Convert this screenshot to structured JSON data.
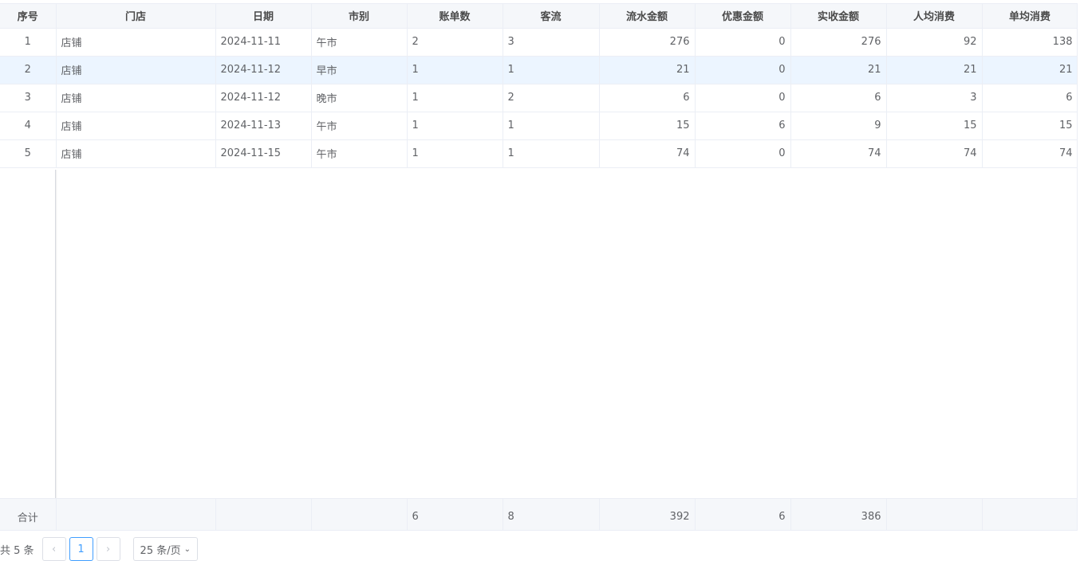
{
  "columns": [
    "序号",
    "门店",
    "日期",
    "市别",
    "账单数",
    "客流",
    "流水金额",
    "优惠金额",
    "实收金额",
    "人均消费",
    "单均消费"
  ],
  "rows": [
    [
      "1",
      "店铺",
      "2024-11-11",
      "午市",
      "2",
      "3",
      "276",
      "0",
      "276",
      "92",
      "138"
    ],
    [
      "2",
      "店铺",
      "2024-11-12",
      "早市",
      "1",
      "1",
      "21",
      "0",
      "21",
      "21",
      "21"
    ],
    [
      "3",
      "店铺",
      "2024-11-12",
      "晚市",
      "1",
      "2",
      "6",
      "0",
      "6",
      "3",
      "6"
    ],
    [
      "4",
      "店铺",
      "2024-11-13",
      "午市",
      "1",
      "1",
      "15",
      "6",
      "9",
      "15",
      "15"
    ],
    [
      "5",
      "店铺",
      "2024-11-15",
      "午市",
      "1",
      "1",
      "74",
      "0",
      "74",
      "74",
      "74"
    ]
  ],
  "summary": [
    "合计",
    "",
    "",
    "",
    "6",
    "8",
    "392",
    "6",
    "386",
    "",
    ""
  ],
  "pagination": {
    "total_text": "共 5 条",
    "current_page": "1",
    "page_size_text": "25 条/页"
  },
  "colors": {
    "header_bg": "#f5f7fa",
    "highlight_row_bg": "#ecf5ff",
    "active_page": "#409eff"
  }
}
